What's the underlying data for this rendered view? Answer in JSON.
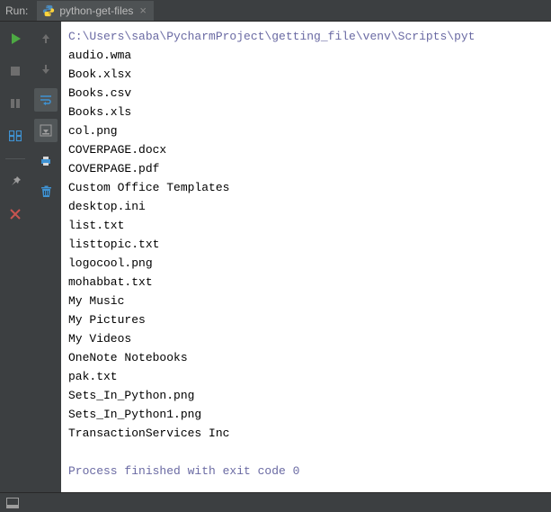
{
  "header": {
    "run_label": "Run:",
    "tab_label": "python-get-files",
    "tab_close": "×"
  },
  "console": {
    "command": "C:\\Users\\saba\\PycharmProject\\getting_file\\venv\\Scripts\\pyt",
    "output": [
      "audio.wma",
      "Book.xlsx",
      "Books.csv",
      "Books.xls",
      "col.png",
      "COVERPAGE.docx",
      "COVERPAGE.pdf",
      "Custom Office Templates",
      "desktop.ini",
      "list.txt",
      "listtopic.txt",
      "logocool.png",
      "mohabbat.txt",
      "My Music",
      "My Pictures",
      "My Videos",
      "OneNote Notebooks",
      "pak.txt",
      "Sets_In_Python.png",
      "Sets_In_Python1.png",
      "TransactionServices Inc"
    ],
    "exit_message": "Process finished with exit code 0"
  }
}
